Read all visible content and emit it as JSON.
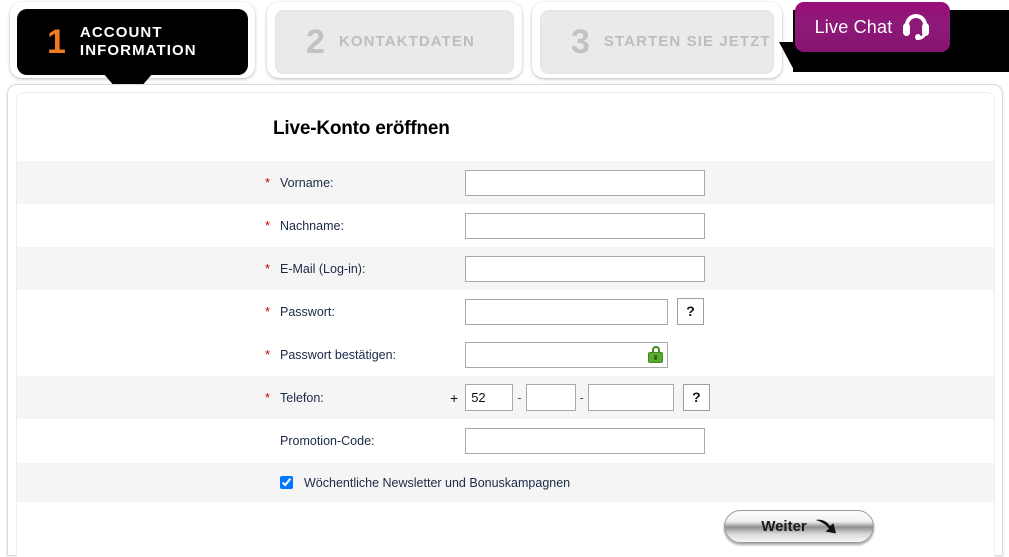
{
  "steps": [
    {
      "number": "1",
      "label_line1": "ACCOUNT",
      "label_line2": "INFORMATION",
      "state": "active"
    },
    {
      "number": "2",
      "label_line1": "KONTAKTDATEN",
      "label_line2": "",
      "state": "inactive"
    },
    {
      "number": "3",
      "label_line1": "STARTEN SIE JETZT",
      "label_line2": "",
      "state": "inactive"
    }
  ],
  "live_chat": {
    "label": "Live Chat",
    "icon": "headset-icon",
    "color": "#91117a"
  },
  "form": {
    "title": "Live-Konto eröffnen",
    "required_marker": "*",
    "fields": {
      "vorname": {
        "label": "Vorname:",
        "value": "",
        "placeholder": "",
        "required": true
      },
      "nachname": {
        "label": "Nachname:",
        "value": "",
        "placeholder": "",
        "required": true
      },
      "email": {
        "label": "E-Mail (Log-in):",
        "value": "",
        "placeholder": "",
        "required": true
      },
      "passwort": {
        "label": "Passwort:",
        "value": "",
        "placeholder": "",
        "required": true,
        "help": "?"
      },
      "passwort_bestaetigen": {
        "label": "Passwort bestätigen:",
        "value": "",
        "placeholder": "",
        "required": true,
        "icon": "lock-icon"
      },
      "telefon": {
        "label": "Telefon:",
        "required": true,
        "prefix_symbol": "+",
        "country_code": "52",
        "separator": "-",
        "area": "",
        "number": "",
        "help": "?"
      },
      "promotion_code": {
        "label": "Promotion-Code:",
        "value": "",
        "placeholder": "",
        "required": false
      }
    },
    "newsletter": {
      "label": "Wöchentliche Newsletter und Bonuskampagnen",
      "checked": true
    },
    "submit": {
      "label": "Weiter",
      "icon": "arrow-right-curved-icon"
    }
  },
  "colors": {
    "accent_orange": "#ef7c20",
    "chat_magenta": "#91117a",
    "required_red": "#cc0000",
    "label_navy": "#1b2a45",
    "row_shade": "#f5f5f5",
    "lock_green": "#5aaa2c"
  }
}
